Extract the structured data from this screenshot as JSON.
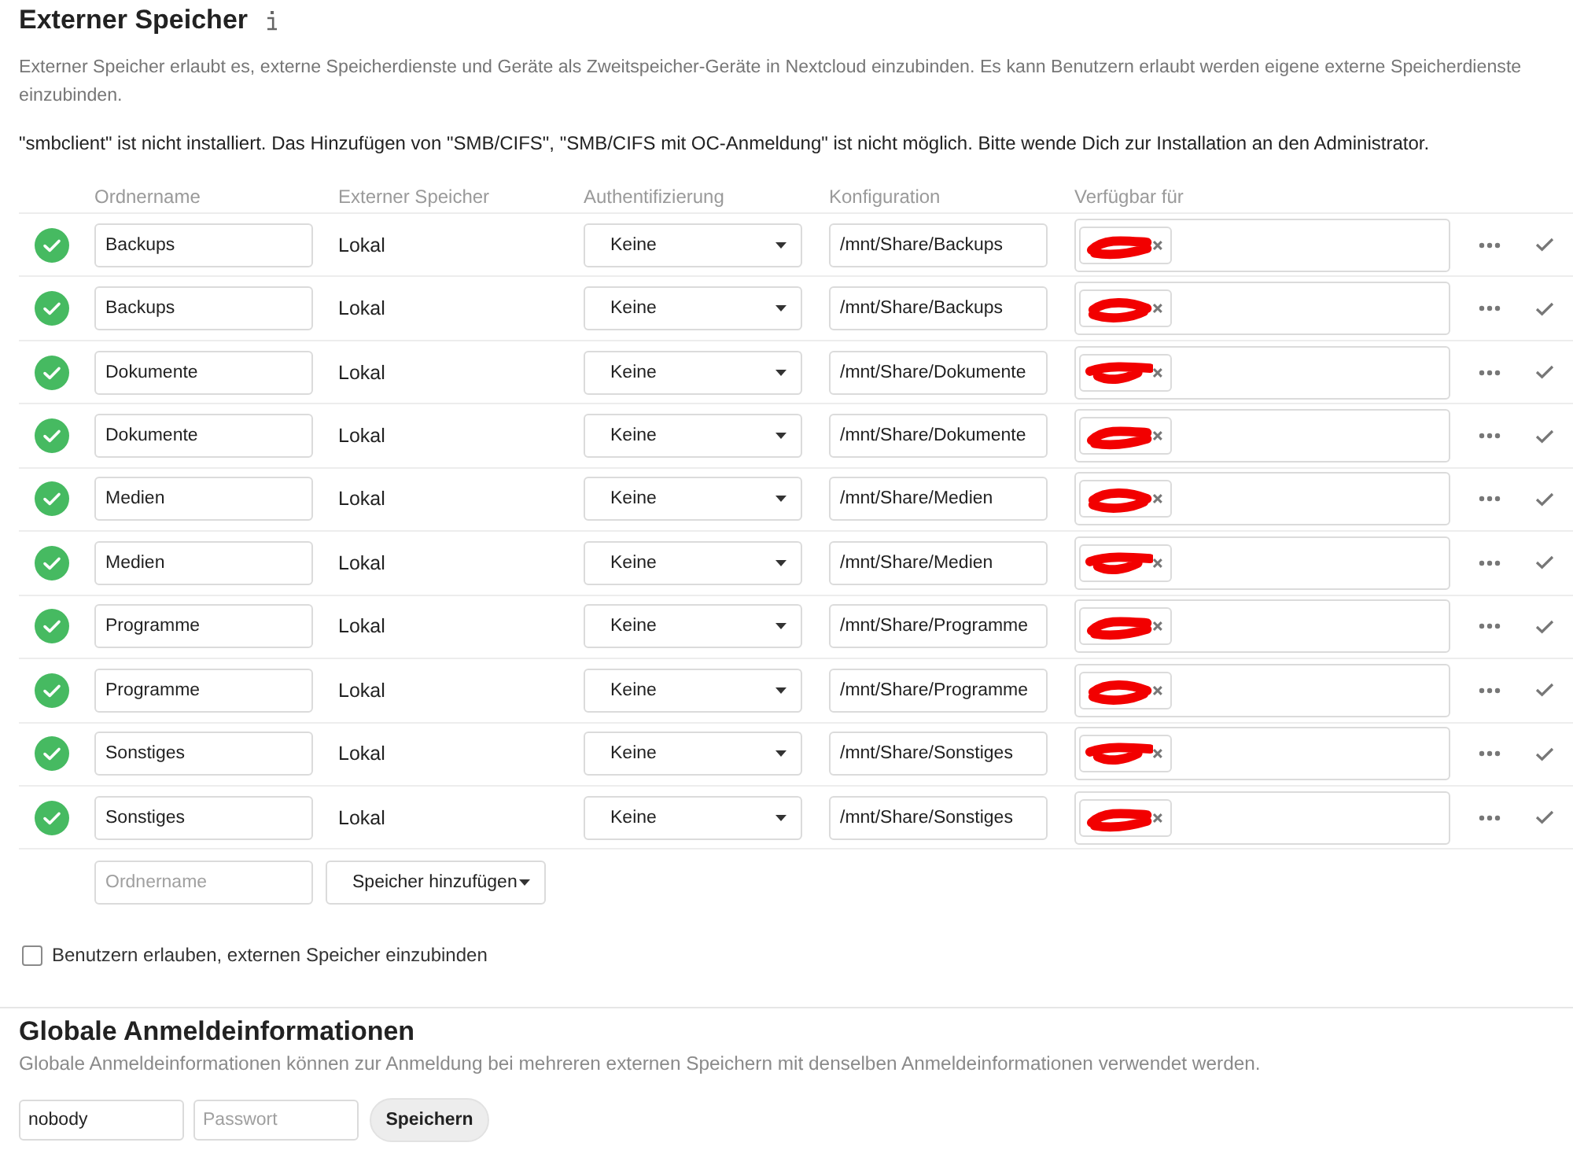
{
  "section": {
    "title": "Externer Speicher",
    "description": "Externer Speicher erlaubt es, externe Speicherdienste und Geräte als Zweitspeicher-Geräte in Nextcloud einzubinden. Es kann Benutzern erlaubt werden eigene externe Speicherdienste einzubinden.",
    "warning": "\"smbclient\" ist nicht installiert. Das Hinzufügen von \"SMB/CIFS\", \"SMB/CIFS mit OC-Anmeldung\" ist nicht möglich. Bitte wende Dich zur Installation an den Administrator."
  },
  "table": {
    "columns": [
      "Ordnername",
      "Externer Speicher",
      "Authentifizierung",
      "Konfiguration",
      "Verfügbar für"
    ],
    "rows": [
      {
        "ok": true,
        "folder_name": "Backups",
        "storage": "Lokal",
        "authentication": "Keine",
        "configuration": "/mnt/Share/Backups",
        "available_for": [
          {
            "kind": "redacted"
          }
        ]
      },
      {
        "ok": true,
        "folder_name": "Backups",
        "storage": "Lokal",
        "authentication": "Keine",
        "configuration": "/mnt/Share/Backups",
        "available_for": [
          {
            "kind": "redacted"
          }
        ]
      },
      {
        "ok": true,
        "folder_name": "Dokumente",
        "storage": "Lokal",
        "authentication": "Keine",
        "configuration": "/mnt/Share/Dokumente",
        "available_for": [
          {
            "kind": "redacted"
          }
        ]
      },
      {
        "ok": true,
        "folder_name": "Dokumente",
        "storage": "Lokal",
        "authentication": "Keine",
        "configuration": "/mnt/Share/Dokumente",
        "available_for": [
          {
            "kind": "redacted"
          }
        ]
      },
      {
        "ok": true,
        "folder_name": "Medien",
        "storage": "Lokal",
        "authentication": "Keine",
        "configuration": "/mnt/Share/Medien",
        "available_for": [
          {
            "kind": "redacted"
          }
        ]
      },
      {
        "ok": true,
        "folder_name": "Medien",
        "storage": "Lokal",
        "authentication": "Keine",
        "configuration": "/mnt/Share/Medien",
        "available_for": [
          {
            "kind": "redacted"
          }
        ]
      },
      {
        "ok": true,
        "folder_name": "Programme",
        "storage": "Lokal",
        "authentication": "Keine",
        "configuration": "/mnt/Share/Programme",
        "available_for": [
          {
            "kind": "redacted"
          }
        ]
      },
      {
        "ok": true,
        "folder_name": "Programme",
        "storage": "Lokal",
        "authentication": "Keine",
        "configuration": "/mnt/Share/Programme",
        "available_for": [
          {
            "kind": "redacted"
          }
        ]
      },
      {
        "ok": true,
        "folder_name": "Sonstiges",
        "storage": "Lokal",
        "authentication": "Keine",
        "configuration": "/mnt/Share/Sonstiges",
        "available_for": [
          {
            "kind": "redacted"
          }
        ]
      },
      {
        "ok": true,
        "folder_name": "Sonstiges",
        "storage": "Lokal",
        "authentication": "Keine",
        "configuration": "/mnt/Share/Sonstiges",
        "available_for": [
          {
            "kind": "redacted"
          }
        ]
      }
    ]
  },
  "add_row": {
    "folder_name": {
      "placeholder": "Ordnername"
    },
    "storage_select": "Speicher hinzufügen"
  },
  "allow_users": {
    "label": "Benutzern erlauben, externen Speicher einzubinden",
    "checked": false
  },
  "global_credentials": {
    "title": "Globale Anmeldeinformationen",
    "description": "Globale Anmeldeinformationen können zur Anmeldung bei mehreren externen Speichern mit denselben Anmeldeinformationen verwendet werden.",
    "user": {
      "value": "nobody"
    },
    "password": {
      "placeholder": "Passwort"
    },
    "save_button": "Speichern"
  }
}
